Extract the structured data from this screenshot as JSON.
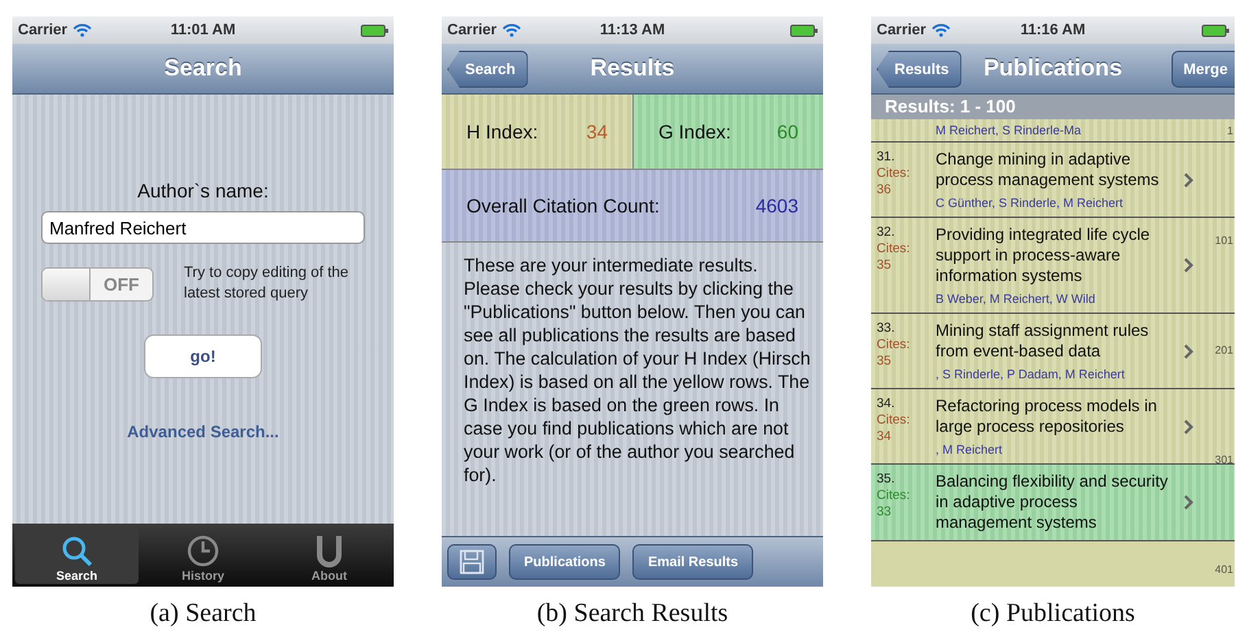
{
  "search_screen": {
    "status_bar": {
      "carrier": "Carrier",
      "time": "11:01 AM"
    },
    "title": "Search",
    "author_label": "Author`s name:",
    "author_field": {
      "value": "Manfred Reichert"
    },
    "toggle": {
      "on": false,
      "label": "OFF"
    },
    "toggle_hint": "Try to copy editing of the latest stored query",
    "go_button": "go!",
    "advanced_link": "Advanced Search...",
    "tabs": [
      {
        "kind": "search",
        "label": "Search",
        "selected": true
      },
      {
        "kind": "history",
        "label": "History",
        "selected": false
      },
      {
        "kind": "about",
        "label": "About",
        "selected": false
      }
    ],
    "caption": "(a) Search"
  },
  "results_screen": {
    "status_bar": {
      "carrier": "Carrier",
      "time": "11:13 AM"
    },
    "back_button": "Search",
    "title": "Results",
    "h_index": {
      "label": "H Index:",
      "value": "34"
    },
    "g_index": {
      "label": "G Index:",
      "value": "60"
    },
    "citations": {
      "label": "Overall Citation Count:",
      "value": "4603"
    },
    "info_text": "These are your intermediate results. Please check your results by clicking the \"Publications\" button below. Then you can see all publications the results are based on. The calculation of your H Index (Hirsch Index) is based on all the yellow rows. The G Index is based on the green rows. In case you find publications which are not your work (or of the author you searched for).",
    "toolbar": [
      {
        "kind": "save"
      },
      {
        "kind": "text",
        "label": "Publications"
      },
      {
        "kind": "text",
        "label": "Email Results"
      }
    ],
    "caption": "(b) Search Results"
  },
  "publications_screen": {
    "status_bar": {
      "carrier": "Carrier",
      "time": "11:16 AM"
    },
    "back_button": "Results",
    "title": "Publications",
    "right_button": "Merge",
    "section_header": "Results: 1 - 100",
    "partial_row_authors": "M Reichert, S Rinderle-Ma",
    "rows": [
      {
        "kind": "h",
        "number": "31.",
        "cites_label": "Cites:",
        "cites": "36",
        "title": "Change mining in adaptive process management systems",
        "authors": "C Günther, S Rinderle, M Reichert"
      },
      {
        "kind": "h",
        "number": "32.",
        "cites_label": "Cites:",
        "cites": "35",
        "title": "Providing integrated life cycle support in process-aware information systems",
        "authors": "B Weber, M Reichert, W Wild"
      },
      {
        "kind": "h",
        "number": "33.",
        "cites_label": "Cites:",
        "cites": "35",
        "title": "Mining staff assignment rules from event-based data",
        "authors": ", S Rinderle, P Dadam, M Reichert"
      },
      {
        "kind": "h",
        "number": "34.",
        "cites_label": "Cites:",
        "cites": "34",
        "title": "Refactoring process models in large process repositories",
        "authors": ", M Reichert"
      },
      {
        "kind": "g",
        "number": "35.",
        "cites_label": "Cites:",
        "cites": "33",
        "title": "Balancing flexibility and security in adaptive process management systems"
      }
    ],
    "index_labels": [
      "1",
      "101",
      "201",
      "301",
      "401"
    ],
    "caption": "(c) Publications"
  }
}
